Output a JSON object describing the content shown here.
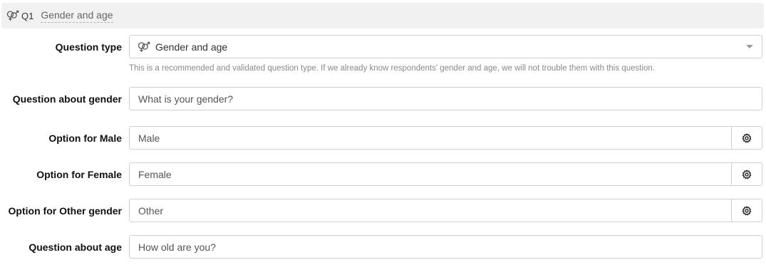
{
  "header": {
    "icon": "gender-icon",
    "question_number": "Q1",
    "question_title": "Gender and age"
  },
  "question_type": {
    "label": "Question type",
    "icon": "gender-icon",
    "selected": "Gender and age",
    "hint": "This is a recommended and validated question type. If we already know respondents' gender and age, we will not trouble them with this question."
  },
  "fields": {
    "gender_question": {
      "label": "Question about gender",
      "value": "What is your gender?"
    },
    "option_male": {
      "label": "Option for Male",
      "value": "Male"
    },
    "option_female": {
      "label": "Option for Female",
      "value": "Female"
    },
    "option_other": {
      "label": "Option for Other gender",
      "value": "Other"
    },
    "age_question": {
      "label": "Question about age",
      "value": "How old are you?"
    }
  },
  "colors": {
    "header_bg": "#f1f1f1",
    "border": "#d0d0d0",
    "hint_text": "#8a8a8a"
  }
}
